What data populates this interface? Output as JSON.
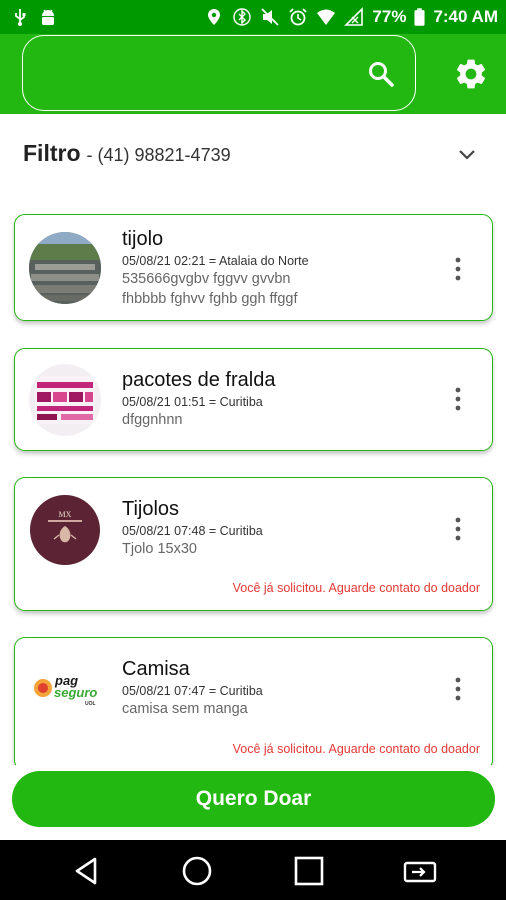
{
  "status_bar": {
    "battery": "77%",
    "time": "7:40 AM"
  },
  "header": {
    "search": {
      "placeholder": "",
      "value": ""
    }
  },
  "filter": {
    "title": "Filtro",
    "phone": "- (41) 98821-4739"
  },
  "items": [
    {
      "title": "tijolo",
      "meta": "05/08/21 02:21 = Atalaia do Norte",
      "desc_lines": [
        "535666gvgbv fggvv gvvbn",
        "fhbbbb fghvv fghb ggh ffggf"
      ],
      "status": ""
    },
    {
      "title": "pacotes de fralda",
      "meta": "05/08/21 01:51 = Curitiba",
      "desc_lines": [
        "dfggnhnn"
      ],
      "status": ""
    },
    {
      "title": "Tijolos",
      "meta": "05/08/21 07:48 = Curitiba",
      "desc_lines": [
        "Tjolo 15x30"
      ],
      "status": "Você já solicitou. Aguarde contato do doador"
    },
    {
      "title": "Camisa",
      "meta": "05/08/21 07:47 = Curitiba",
      "desc_lines": [
        "camisa sem manga"
      ],
      "status": "Você já solicitou. Aguarde contato do doador"
    }
  ],
  "logos": {
    "item3_small": "MX",
    "item4_line1": "pag",
    "item4_line2": "seguro",
    "item4_line3": "UOL"
  },
  "cta": {
    "label": "Quero Doar"
  },
  "colors": {
    "primary": "#22b811",
    "status_bar": "#009a00",
    "warning_text": "#e53935",
    "avatar_maroon": "#5b2333"
  }
}
